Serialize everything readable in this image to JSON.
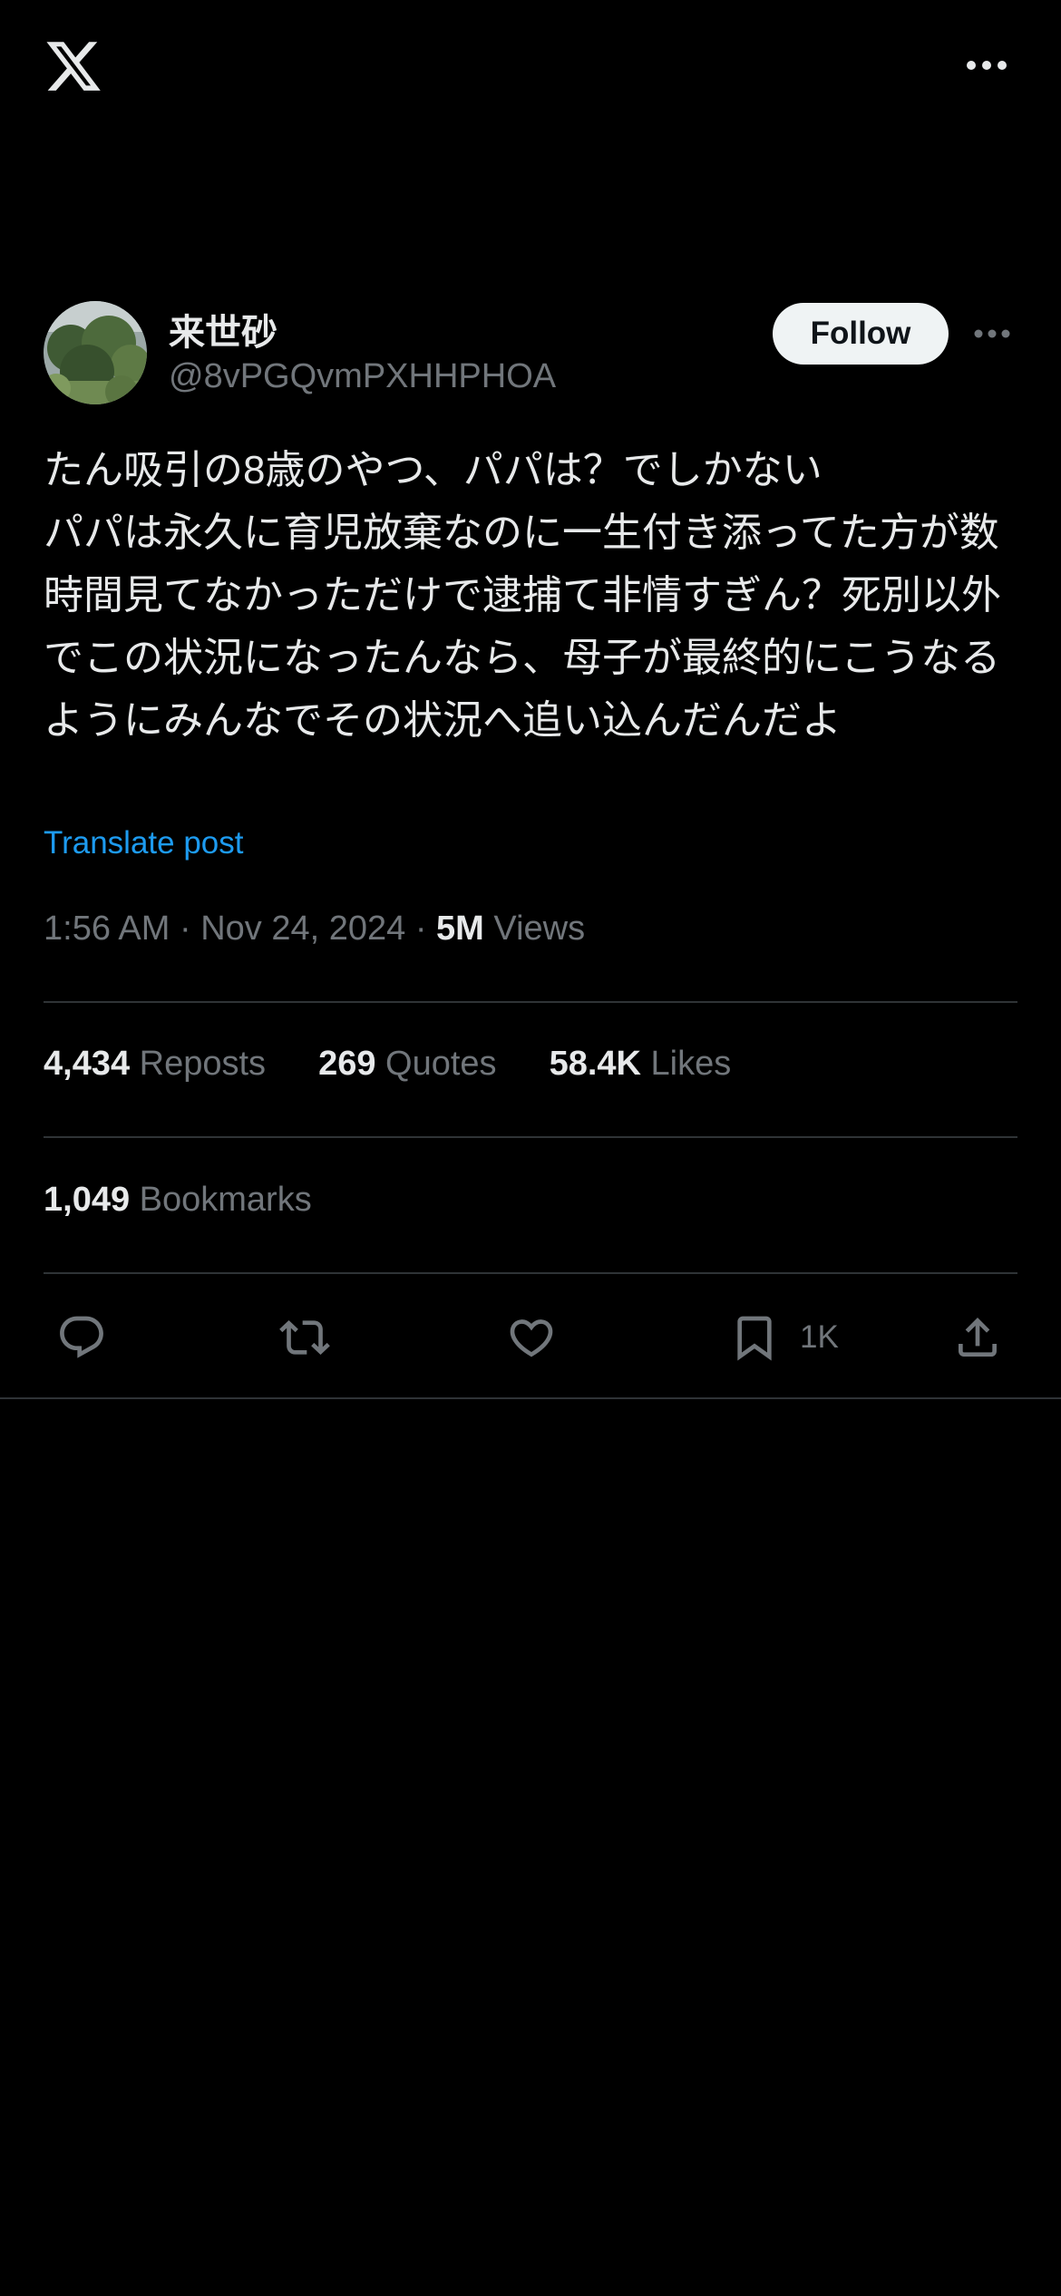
{
  "header": {
    "logo_icon": "x-logo-icon",
    "more_icon": "more-horizontal-icon"
  },
  "post": {
    "author": {
      "display_name": "来世砂",
      "handle": "@8vPGQvmPXHHPHOA",
      "avatar_icon": "avatar-image"
    },
    "follow_label": "Follow",
    "text": "たん吸引の8歳のやつ、パパは？でしかない\nパパは永久に育児放棄なのに一生付き添ってた方が数時間見てなかっただけで逮捕て非情すぎん？死別以外でこの状況になったんなら、母子が最終的にこうなるようにみんなでその状況へ追い込んだんだよ",
    "translate_label": "Translate post",
    "time": "1:56 AM",
    "separator": "·",
    "date": "Nov 24, 2024",
    "views_count": "5M",
    "views_label": "Views",
    "stats": {
      "reposts_count": "4,434",
      "reposts_label": "Reposts",
      "quotes_count": "269",
      "quotes_label": "Quotes",
      "likes_count": "58.4K",
      "likes_label": "Likes",
      "bookmarks_count": "1,049",
      "bookmarks_label": "Bookmarks"
    },
    "actions": {
      "reply_icon": "reply-icon",
      "repost_icon": "repost-icon",
      "like_icon": "heart-icon",
      "bookmark_icon": "bookmark-icon",
      "bookmark_count": "1K",
      "share_icon": "share-icon"
    }
  },
  "colors": {
    "background": "#000000",
    "text_primary": "#e7e9ea",
    "text_secondary": "#71767b",
    "link": "#1d9bf0",
    "divider": "#2f3336",
    "follow_bg": "#eff3f4"
  }
}
